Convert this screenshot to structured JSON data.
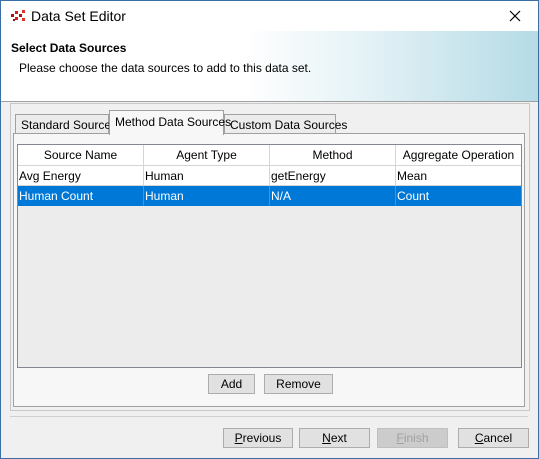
{
  "window": {
    "title": "Data Set Editor",
    "app_icon": "repast-icon",
    "close_icon": "close-icon"
  },
  "header": {
    "heading": "Select Data Sources",
    "description": "Please choose the data sources to add to this data set."
  },
  "tabs": [
    {
      "label": "Standard Sources",
      "active": false
    },
    {
      "label": "Method Data Sources",
      "active": true
    },
    {
      "label": "Custom Data Sources",
      "active": false
    }
  ],
  "table": {
    "columns": [
      "Source Name",
      "Agent Type",
      "Method",
      "Aggregate Operation"
    ],
    "rows": [
      {
        "cells": [
          "Avg Energy",
          "Human",
          "getEnergy",
          "Mean"
        ],
        "selected": false
      },
      {
        "cells": [
          "Human Count",
          "Human",
          "N/A",
          "Count"
        ],
        "selected": true
      }
    ]
  },
  "actions": {
    "add_label": "Add",
    "remove_label": "Remove"
  },
  "wizard": {
    "previous_label": "Previous",
    "previous_mnemonic": "P",
    "previous_rest": "revious",
    "next_label": "Next",
    "next_mnemonic": "N",
    "next_rest": "ext",
    "finish_label": "Finish",
    "finish_mnemonic": "F",
    "finish_rest": "inish",
    "finish_enabled": false,
    "cancel_label": "Cancel",
    "cancel_mnemonic": "C",
    "cancel_rest": "ancel"
  },
  "colors": {
    "selection": "#0078d7",
    "banner_accent": "#b5dbe6",
    "window_border": "#3a6ea5"
  }
}
